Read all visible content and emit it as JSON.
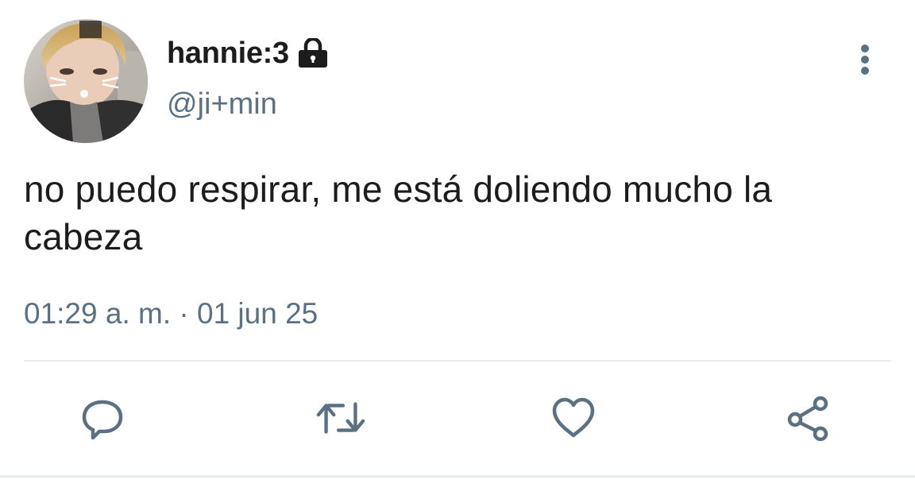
{
  "tweet": {
    "display_name": "hannie:3",
    "handle": "@ji+min",
    "text": "no puedo respirar, me está doliendo mucho la cabeza",
    "timestamp": "01:29 a. m. · 01 jun 25",
    "locked": true
  },
  "icons": {
    "lock": "lock-icon",
    "more": "more-vertical-icon",
    "reply": "reply-icon",
    "retweet": "retweet-icon",
    "like": "heart-icon",
    "share": "share-icon"
  },
  "colors": {
    "text_primary": "#1c1c1c",
    "text_secondary": "#5b7083",
    "divider": "#e6ecf0",
    "icon": "#5b7083"
  }
}
